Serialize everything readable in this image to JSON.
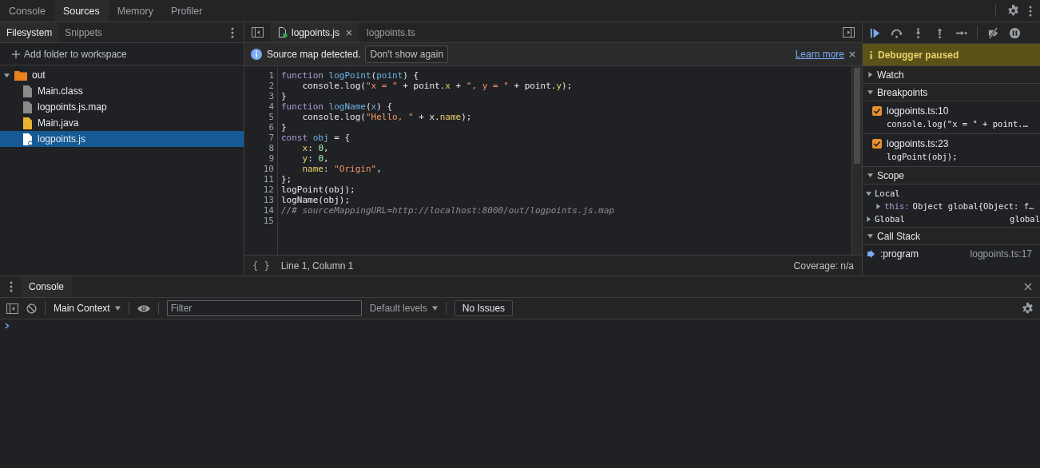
{
  "main_tabs": [
    {
      "label": "Console",
      "selected": false
    },
    {
      "label": "Sources",
      "selected": true
    },
    {
      "label": "Memory",
      "selected": false
    },
    {
      "label": "Profiler",
      "selected": false
    }
  ],
  "navigator": {
    "tabs": [
      {
        "label": "Filesystem",
        "selected": true
      },
      {
        "label": "Snippets",
        "selected": false
      }
    ],
    "add_folder": "Add folder to workspace",
    "tree": [
      {
        "name": "out",
        "kind": "folder",
        "expanded": true,
        "selected": false,
        "children": [
          {
            "name": "Main.class",
            "kind": "generic",
            "selected": false
          },
          {
            "name": "logpoints.js.map",
            "kind": "generic",
            "selected": false
          },
          {
            "name": "Main.java",
            "kind": "java",
            "selected": false
          },
          {
            "name": "logpoints.js",
            "kind": "script",
            "selected": true
          }
        ]
      }
    ]
  },
  "editor": {
    "tabs": [
      {
        "label": "logpoints.js",
        "kind": "script",
        "selected": true,
        "closable": true
      },
      {
        "label": "logpoints.ts",
        "kind": "source",
        "selected": false,
        "closable": false
      }
    ],
    "infobar": {
      "message": "Source map detected.",
      "button": "Don't show again",
      "link": "Learn more"
    },
    "lines": [
      {
        "number": "1",
        "tokens": [
          {
            "text": "function",
            "kind": "keyword"
          },
          {
            "text": " logPoint",
            "kind": "def"
          },
          {
            "text": "(",
            "kind": "plain"
          },
          {
            "text": "point",
            "kind": "def"
          },
          {
            "text": ") {",
            "kind": "plain"
          }
        ]
      },
      {
        "number": "2",
        "tokens": [
          {
            "text": "    console.log(",
            "kind": "plain"
          },
          {
            "text": "\"x = \"",
            "kind": "string"
          },
          {
            "text": " + point.",
            "kind": "plain"
          },
          {
            "text": "x",
            "kind": "property"
          },
          {
            "text": " + ",
            "kind": "plain"
          },
          {
            "text": "\", y = \"",
            "kind": "string"
          },
          {
            "text": " + point.",
            "kind": "plain"
          },
          {
            "text": "y",
            "kind": "property"
          },
          {
            "text": ");",
            "kind": "plain"
          }
        ]
      },
      {
        "number": "3",
        "tokens": [
          {
            "text": "}",
            "kind": "plain"
          }
        ]
      },
      {
        "number": "4",
        "tokens": [
          {
            "text": "function",
            "kind": "keyword"
          },
          {
            "text": " logName",
            "kind": "def"
          },
          {
            "text": "(",
            "kind": "plain"
          },
          {
            "text": "x",
            "kind": "def"
          },
          {
            "text": ") {",
            "kind": "plain"
          }
        ]
      },
      {
        "number": "5",
        "tokens": [
          {
            "text": "    console.log(",
            "kind": "plain"
          },
          {
            "text": "\"Hello, \"",
            "kind": "string"
          },
          {
            "text": " + x.",
            "kind": "plain"
          },
          {
            "text": "name",
            "kind": "property"
          },
          {
            "text": ");",
            "kind": "plain"
          }
        ]
      },
      {
        "number": "6",
        "tokens": [
          {
            "text": "}",
            "kind": "plain"
          }
        ]
      },
      {
        "number": "7",
        "tokens": [
          {
            "text": "const",
            "kind": "keyword"
          },
          {
            "text": " obj",
            "kind": "def"
          },
          {
            "text": " = {",
            "kind": "plain"
          }
        ]
      },
      {
        "number": "8",
        "tokens": [
          {
            "text": "    x",
            "kind": "property"
          },
          {
            "text": ": ",
            "kind": "plain"
          },
          {
            "text": "0",
            "kind": "number"
          },
          {
            "text": ",",
            "kind": "plain"
          }
        ]
      },
      {
        "number": "9",
        "tokens": [
          {
            "text": "    y",
            "kind": "property"
          },
          {
            "text": ": ",
            "kind": "plain"
          },
          {
            "text": "0",
            "kind": "number"
          },
          {
            "text": ",",
            "kind": "plain"
          }
        ]
      },
      {
        "number": "10",
        "tokens": [
          {
            "text": "    name",
            "kind": "property"
          },
          {
            "text": ": ",
            "kind": "plain"
          },
          {
            "text": "\"Origin\"",
            "kind": "string"
          },
          {
            "text": ",",
            "kind": "plain"
          }
        ]
      },
      {
        "number": "11",
        "tokens": [
          {
            "text": "};",
            "kind": "plain"
          }
        ]
      },
      {
        "number": "12",
        "tokens": [
          {
            "text": "logPoint(obj);",
            "kind": "plain"
          }
        ]
      },
      {
        "number": "13",
        "tokens": [
          {
            "text": "logName(obj);",
            "kind": "plain"
          }
        ]
      },
      {
        "number": "14",
        "tokens": [
          {
            "text": "//# sourceMappingURL=http://localhost:8000/out/logpoints.js.map",
            "kind": "comment"
          }
        ]
      },
      {
        "number": "15"
      }
    ],
    "status": {
      "pretty_print": "{ }",
      "position": "Line 1, Column 1",
      "coverage": "Coverage: n/a"
    }
  },
  "debugger": {
    "banner": "Debugger paused",
    "watch": {
      "title": "Watch",
      "expanded": false
    },
    "breakpoints": {
      "title": "Breakpoints",
      "expanded": true,
      "items": [
        {
          "location": "logpoints.ts:10",
          "code": "console.log(\"x = \" + point.…",
          "checked": true
        },
        {
          "location": "logpoints.ts:23",
          "code": "logPoint(obj);",
          "checked": true
        }
      ]
    },
    "scope": {
      "title": "Scope",
      "expanded": true,
      "items": [
        {
          "name": "Local",
          "expanded": true,
          "children": [
            {
              "name": "this:",
              "value": "Object global{Object: f…",
              "expanded": false
            }
          ]
        },
        {
          "name": "Global",
          "value": "global",
          "expanded": false
        }
      ]
    },
    "call_stack": {
      "title": "Call Stack",
      "expanded": true,
      "frames": [
        {
          "name": ":program",
          "location": "logpoints.ts:17",
          "selected": true
        }
      ]
    }
  },
  "console": {
    "tabs": [
      {
        "label": "Console",
        "selected": true
      }
    ],
    "context": "Main Context",
    "filter_placeholder": "Filter",
    "levels": "Default levels",
    "issues": "No Issues"
  }
}
